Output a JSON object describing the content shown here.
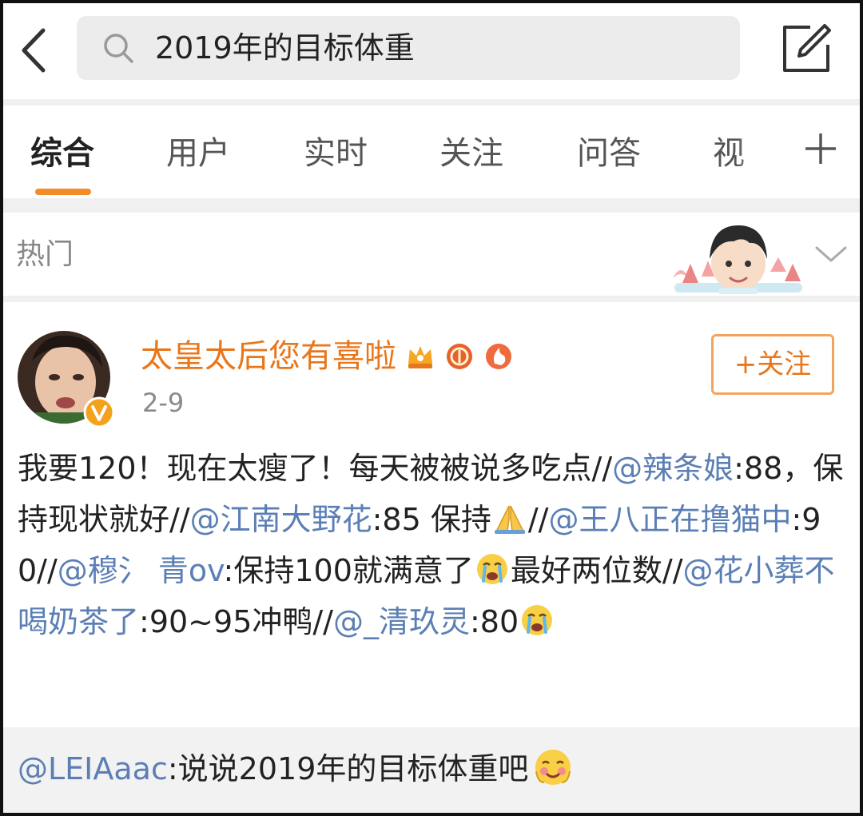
{
  "search": {
    "query": "2019年的目标体重"
  },
  "tabs": [
    {
      "label": "综合"
    },
    {
      "label": "用户"
    },
    {
      "label": "实时"
    },
    {
      "label": "关注"
    },
    {
      "label": "问答"
    },
    {
      "label": "视"
    }
  ],
  "hot_section": {
    "label": "热门"
  },
  "post": {
    "author": "太皇太后您有喜啦",
    "date": "2-9",
    "follow_label": "+关注",
    "body": {
      "t1": "我要120！现在太瘦了！每天被被说多吃点//",
      "m1": "@辣条娘",
      "t2": ":88，保持现状就好//",
      "m2": "@江南大野花",
      "t3": ":85 保持",
      "t4": "//",
      "m3": "@王八正在撸猫中",
      "t5": ":90//",
      "m4": "@穆氵 青ov",
      "t6": ":保持100就满意了",
      "t7": "最好两位数//",
      "m5": "@花小葬不喝奶茶了",
      "t8": ":90~95冲鸭//",
      "m6": "@_清玖灵",
      "t9": ":80"
    },
    "quote": {
      "mention": "@LEIAaac",
      "text": ":说说2019年的目标体重吧"
    }
  },
  "colors": {
    "accent_orange": "#e8761b",
    "tab_underline": "#f28c28",
    "mention_blue": "#5b7fb5",
    "search_bg": "#ececec",
    "quote_bg": "#f2f2f2"
  },
  "icons": {
    "back": "chevron-left-icon",
    "search": "search-icon",
    "compose": "compose-icon",
    "more_tabs": "plus-icon",
    "expand": "chevron-down-icon",
    "verified": "verified-v-icon",
    "pray": "praying-hands-emoji",
    "cry": "crying-face-emoji",
    "shy": "blushing-face-emoji"
  }
}
